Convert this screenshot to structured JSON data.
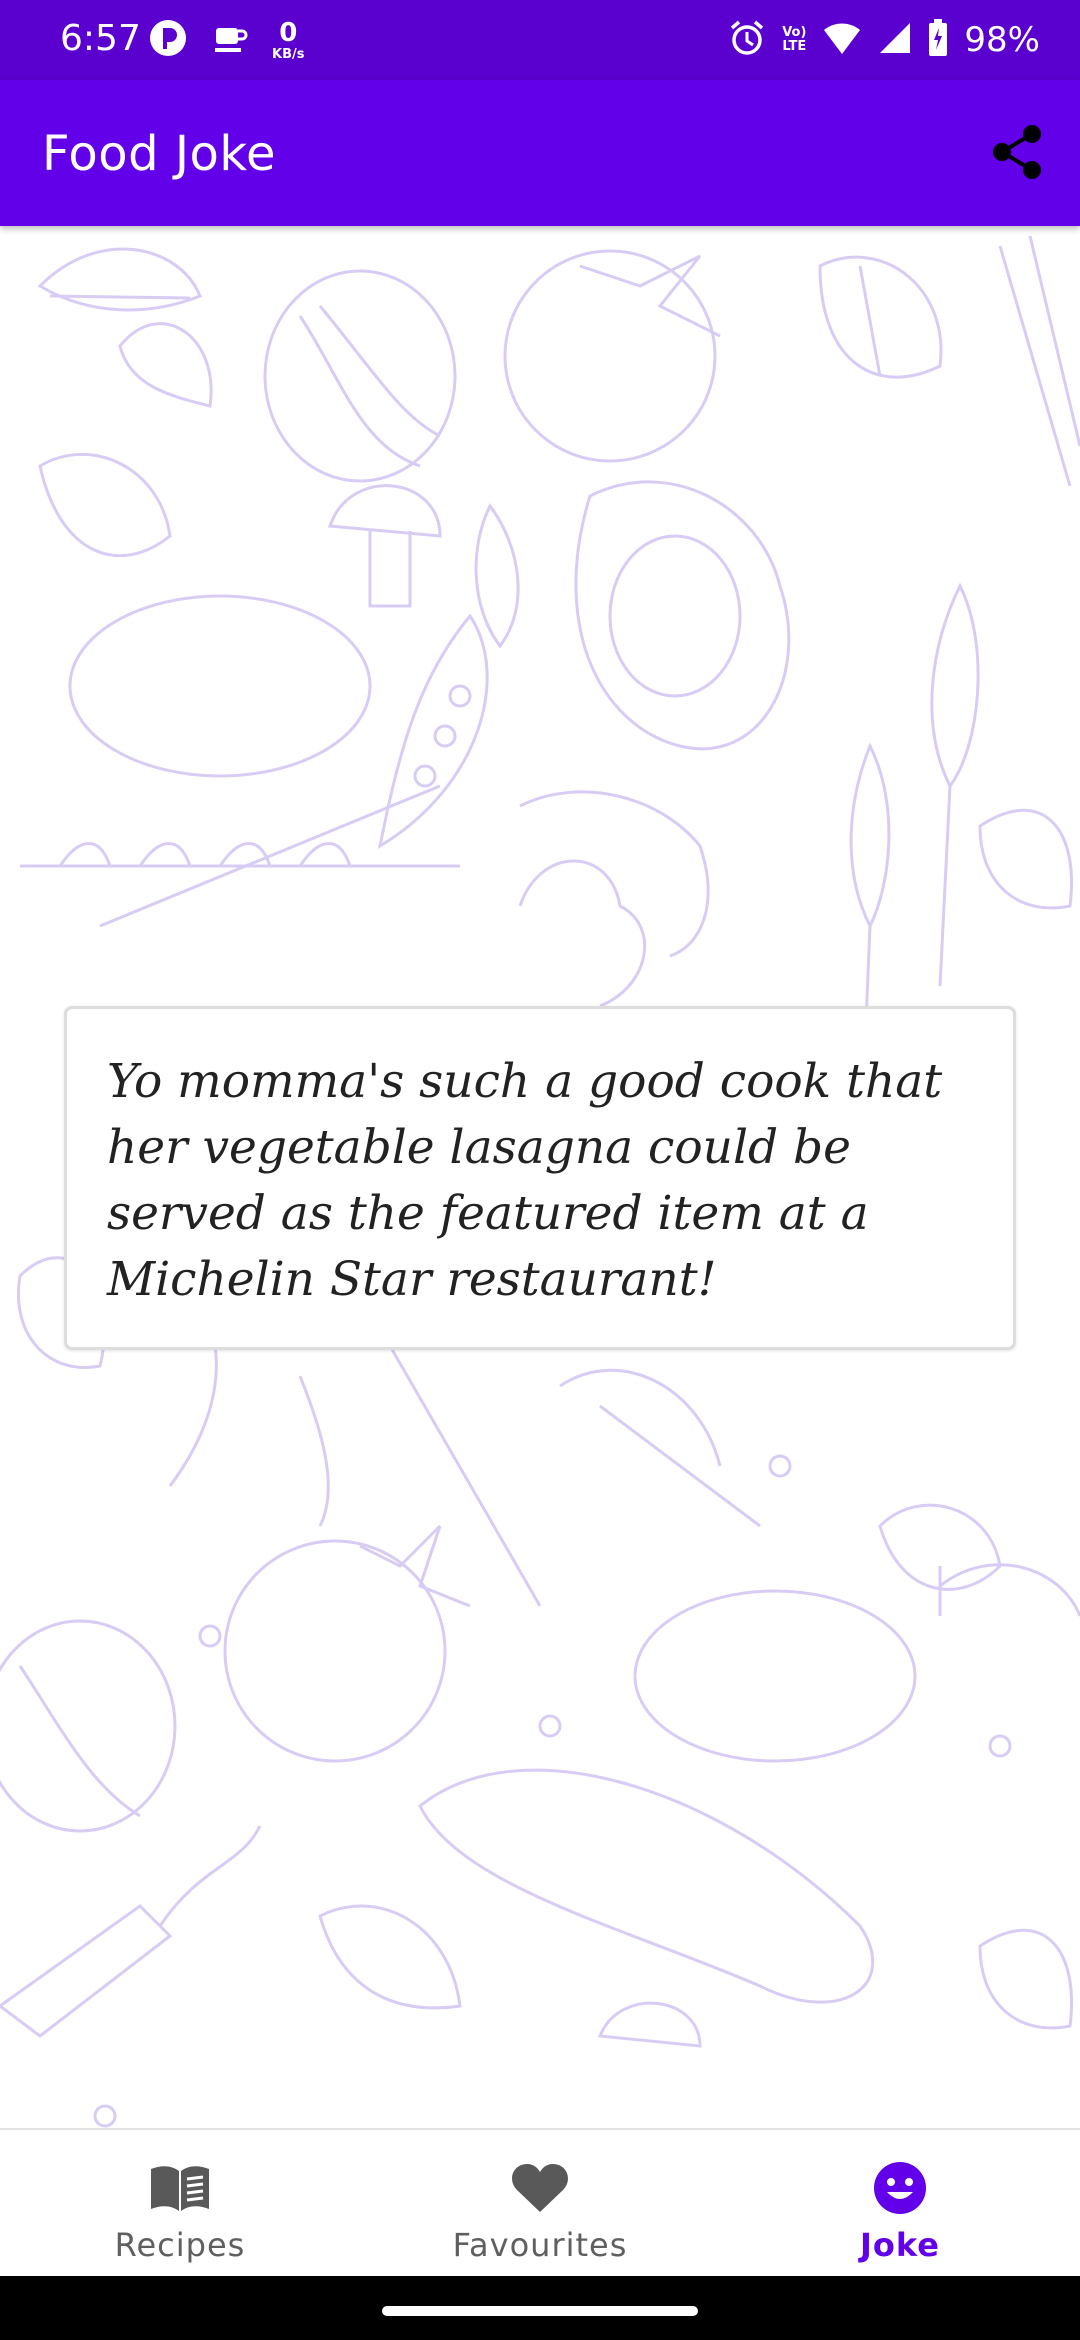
{
  "status_bar": {
    "time": "6:57",
    "net_speed_value": "0",
    "net_speed_unit": "KB/s",
    "network_label_top": "Vo)",
    "network_label_bottom": "LTE",
    "battery_percent": "98%"
  },
  "app_bar": {
    "title": "Food Joke",
    "share_icon": "share-icon"
  },
  "joke": {
    "text": "Yo momma's such a good cook that her vegetable lasagna could be served as the featured item at a Michelin Star restaurant!"
  },
  "bottom_nav": {
    "items": [
      {
        "label": "Recipes",
        "icon": "book-icon",
        "active": false
      },
      {
        "label": "Favourites",
        "icon": "heart-icon",
        "active": false
      },
      {
        "label": "Joke",
        "icon": "smiley-icon",
        "active": true
      }
    ]
  },
  "colors": {
    "status_bar": "#5a00cf",
    "primary": "#6200ea",
    "doodle": "#d8ccf4",
    "inactive_nav": "#5f5f5f"
  }
}
